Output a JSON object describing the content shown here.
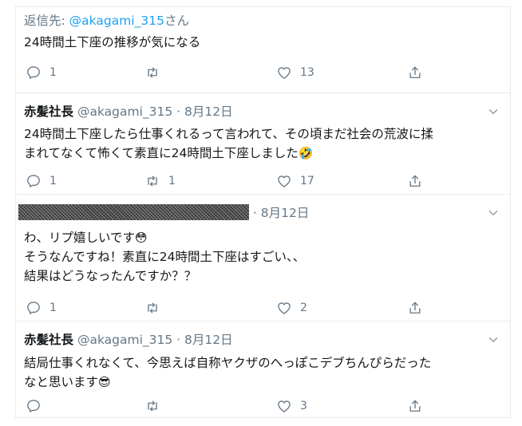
{
  "tweets": [
    {
      "reply_label": "返信先: ",
      "reply_handle": "@akagami_315",
      "reply_suffix": "さん",
      "lines": [
        "24時間土下座の推移が気になる"
      ],
      "counts": {
        "reply": "1",
        "retweet": "",
        "like": "13"
      }
    },
    {
      "name": "赤髪社長",
      "handle": "@akagami_315",
      "date": "8月12日",
      "lines": [
        "24時間土下座したら仕事くれるって言われて、その頃まだ社会の荒波に揉",
        "まれてなくて怖くて素直に24時間土下座しました"
      ],
      "emoji": "🤣",
      "counts": {
        "reply": "1",
        "retweet": "1",
        "like": "17"
      }
    },
    {
      "date": "8月12日",
      "lines": [
        "わ、リプ嬉しいです",
        "そうなんですね！素直に24時間土下座はすごい、、",
        "結果はどうなったんですか？？"
      ],
      "emoji": "😳",
      "counts": {
        "reply": "1",
        "retweet": "",
        "like": "2"
      }
    },
    {
      "name": "赤髪社長",
      "handle": "@akagami_315",
      "date": "8月12日",
      "lines": [
        "結局仕事くれなくて、今思えば自称ヤクザのへっぽこデブちんぴらだった",
        "なと思います"
      ],
      "emoji": "😎",
      "counts": {
        "reply": "",
        "retweet": "",
        "like": "3"
      }
    }
  ],
  "separator": " · ",
  "icons": {
    "reply": "reply-icon",
    "retweet": "retweet-icon",
    "like": "heart-icon",
    "share": "share-icon",
    "menu": "chevron-down-icon"
  },
  "colors": {
    "link": "#1da1f2",
    "muted": "#657786",
    "text": "#14171a",
    "border": "#e6ecf0"
  }
}
